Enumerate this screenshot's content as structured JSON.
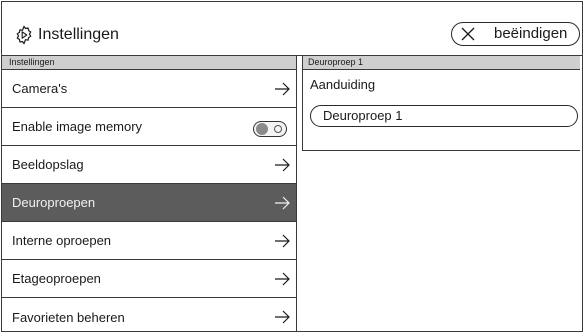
{
  "header": {
    "title": "Instellingen",
    "settings_icon": "gear-icon",
    "end_button": {
      "label": "beëindigen",
      "icon": "close-icon"
    }
  },
  "menu": {
    "section_label": "Instellingen",
    "items": [
      {
        "label": "Camera's",
        "type": "link"
      },
      {
        "label": "Enable image memory",
        "type": "toggle",
        "enabled": false
      },
      {
        "label": "Beeldopslag",
        "type": "link"
      },
      {
        "label": "Deuroproepen",
        "type": "link",
        "active": true
      },
      {
        "label": "Interne oproepen",
        "type": "link"
      },
      {
        "label": "Etageoproepen",
        "type": "link"
      },
      {
        "label": "Favorieten beheren",
        "type": "link"
      }
    ]
  },
  "detail": {
    "section_label": "Deuroproep 1",
    "field_label": "Aanduiding",
    "field_value": "Deuroproep 1"
  },
  "colors": {
    "active_item_bg": "#5c5c5c",
    "section_bar_bg": "#cfcfcf",
    "border": "#3a3a3a"
  }
}
